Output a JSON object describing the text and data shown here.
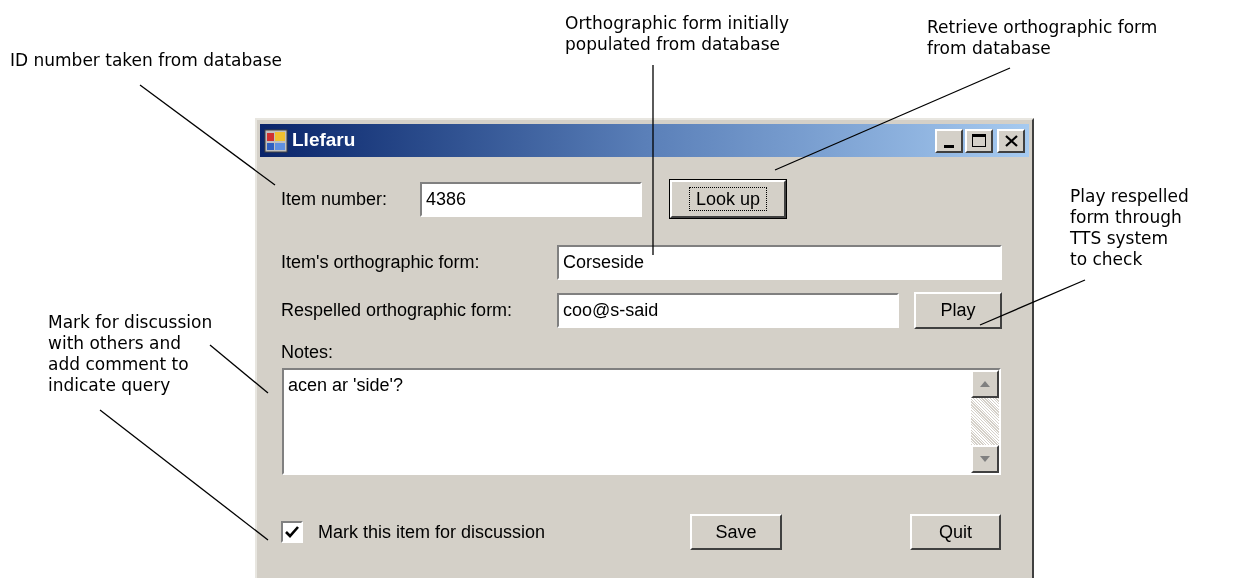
{
  "annotations": [
    {
      "kind": "id",
      "lines": [
        "ID number taken from database"
      ]
    },
    {
      "kind": "ortho",
      "lines": [
        "Orthographic form initially",
        "populated from database"
      ]
    },
    {
      "kind": "retrieve",
      "lines": [
        "Retrieve orthographic form",
        "from database"
      ]
    },
    {
      "kind": "play",
      "lines": [
        "Play respelled",
        "form through",
        "TTS system",
        "to check"
      ]
    },
    {
      "kind": "mark",
      "lines": [
        "Mark for discussion",
        "with others and",
        "add comment to",
        "indicate query"
      ]
    }
  ],
  "window": {
    "title": "Llefaru"
  },
  "form": {
    "item_number": {
      "label": "Item number:",
      "value": "4386"
    },
    "lookup_button": "Look up",
    "orthographic": {
      "label": "Item's orthographic form:",
      "value": "Corseside"
    },
    "respelled": {
      "label": "Respelled orthographic form:",
      "value": "coo@s-said"
    },
    "play_button": "Play",
    "notes": {
      "label": "Notes:",
      "value": "acen ar 'side'?"
    },
    "mark": {
      "label": "Mark this item for discussion",
      "checked": true
    },
    "save_button": "Save",
    "quit_button": "Quit"
  }
}
